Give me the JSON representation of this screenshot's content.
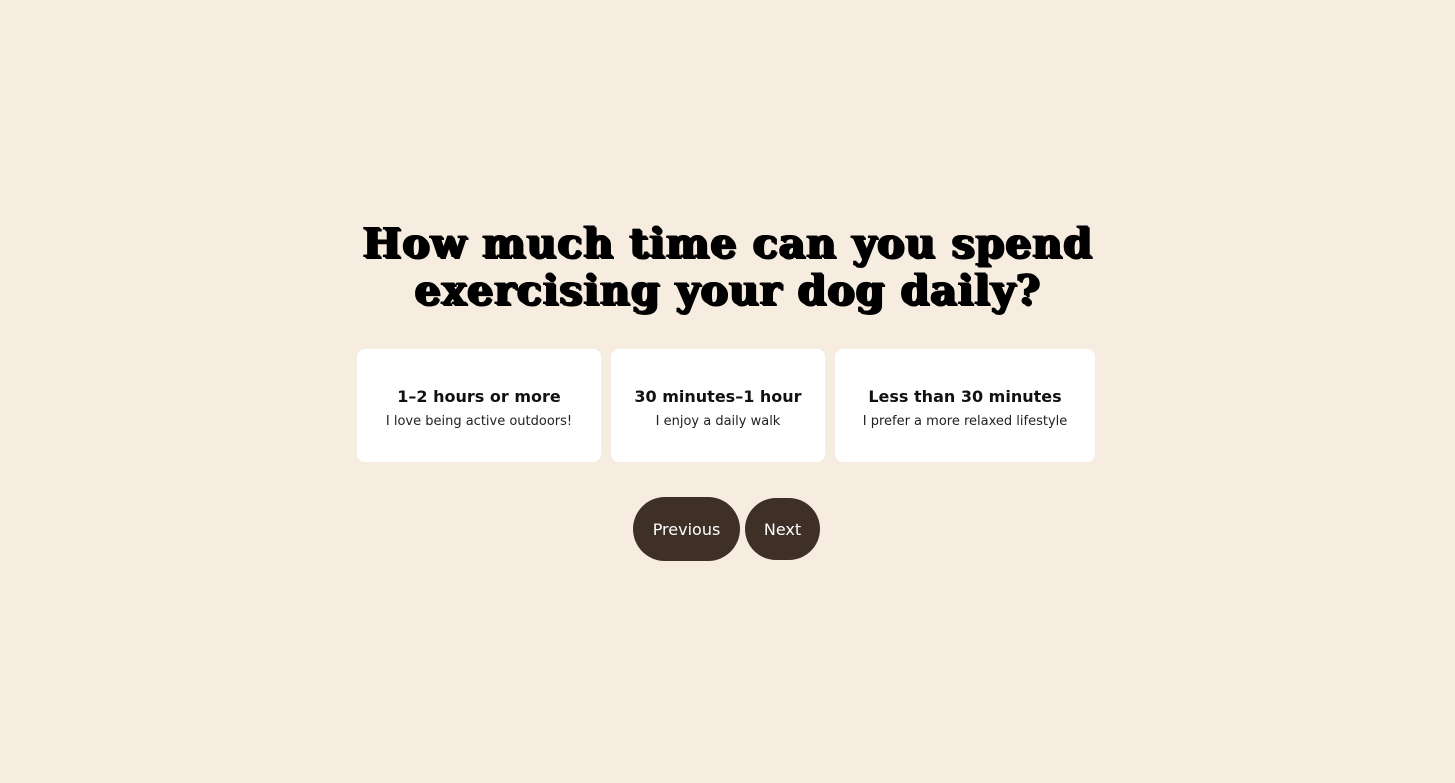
{
  "question": {
    "line1": "How much time can you spend",
    "line2": "exercising your dog daily?"
  },
  "options": [
    {
      "title": "1–2 hours or more",
      "subtitle": "I love being active outdoors!"
    },
    {
      "title": "30 minutes–1 hour",
      "subtitle": "I enjoy a daily walk"
    },
    {
      "title": "Less than 30 minutes",
      "subtitle": "I prefer a more relaxed lifestyle"
    }
  ],
  "nav": {
    "previous_label": "Previous",
    "next_label": "Next"
  },
  "colors": {
    "background": "#f6ede0",
    "card": "#ffffff",
    "button": "#3e2f27",
    "button_text": "#ffffff",
    "heading": "#000000"
  }
}
